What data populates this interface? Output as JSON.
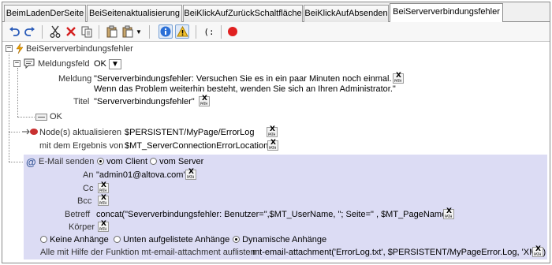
{
  "tabs": [
    {
      "label": "BeimLadenDerSeite"
    },
    {
      "label": "BeiSeitenaktualisierung"
    },
    {
      "label": "BeiKlickAufZurückSchaltfläche"
    },
    {
      "label": "BeiKlickAufAbsenden"
    },
    {
      "label": "BeiSerververbindungsfehler"
    }
  ],
  "toolbar": {
    "icons": [
      "undo-icon",
      "redo-icon",
      "cut-icon",
      "delete-icon",
      "copy-icon",
      "paste-icon",
      "paste-dropdown-icon",
      "info-icon",
      "warning-icon",
      "brackets-icon",
      "record-icon"
    ]
  },
  "tree": {
    "root_label": "BeiSerververbindungsfehler",
    "message_box": {
      "label": "Meldungsfeld",
      "dropdown_value": "OK",
      "message_label": "Meldung",
      "message_line1": "\"Serververbindungsfehler: Versuchen Sie es in ein paar Minuten noch einmal.",
      "message_line2": "Wenn das Problem weiterhin besteht, wenden Sie sich an Ihren Administrator.\"",
      "title_label": "Titel",
      "title_value": "\"Serververbindungsfehler\"",
      "ok_branch": "OK"
    },
    "update_nodes": {
      "label": "Node(s) aktualisieren",
      "target": "$PERSISTENT/MyPage/ErrorLog",
      "with_result_label": "mit dem Ergebnis von",
      "result": "$MT_ServerConnectionErrorLocation"
    },
    "email": {
      "label": "E-Mail senden",
      "from_client": "vom Client",
      "from_server": "vom Server",
      "to_label": "An",
      "to_value": "\"admin01@altova.com\"",
      "cc_label": "Cc",
      "bcc_label": "Bcc",
      "subject_label": "Betreff",
      "subject_value": "concat(\"Seververbindungsfehler: Benutzer=\",$MT_UserName, \"; Seite=\" , $MT_PageName)",
      "body_label": "Körper",
      "attach_none": "Keine Anhänge",
      "attach_listed": "Unten aufgelistete Anhänge",
      "attach_dynamic": "Dynamische Anhänge",
      "attach_list_label": "Alle mit Hilfe der Funktion mt-email-attachment auflisten",
      "attach_list_value": "mt-email-attachment('ErrorLog.txt', $PERSISTENT/MyPageError.Log, 'XML')"
    },
    "xpath_button": {
      "x": "X",
      "path": "PATH"
    }
  },
  "colors": {
    "email_background": "#dcdcf4",
    "info_icon": "#2a6fd6",
    "warning_icon": "#f2c12e",
    "record_icon": "#e02020",
    "delete_icon": "#d42020",
    "lightning_icon": "#e8a000"
  }
}
